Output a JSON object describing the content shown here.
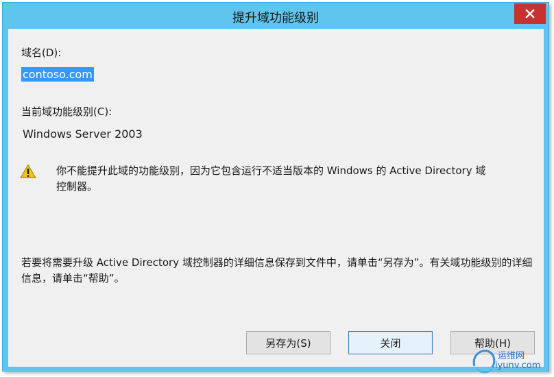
{
  "window": {
    "title": "提升域功能级别"
  },
  "domain": {
    "label": "域名(D):",
    "value": "contoso.com"
  },
  "level": {
    "label": "当前域功能级别(C):",
    "value": "Windows Server 2003"
  },
  "warning": {
    "icon": "warning-icon",
    "message": "你不能提升此域的功能级别，因为它包含运行不适当版本的 Windows 的 Active Directory 域控制器。"
  },
  "info": {
    "message": "若要将需要升级 Active Directory 域控制器的详细信息保存到文件中，请单击“另存为”。有关域功能级别的详细信息，请单击“帮助”。"
  },
  "buttons": {
    "save_as": "另存为(S)",
    "close": "关闭",
    "help": "帮助(H)"
  },
  "watermark": {
    "line1": "运维网",
    "line2": "iyunv.com"
  },
  "colors": {
    "titlebar": "#5fc5ec",
    "close": "#c7312f",
    "selection": "#3399ff",
    "content_bg": "#f0f0f0"
  }
}
